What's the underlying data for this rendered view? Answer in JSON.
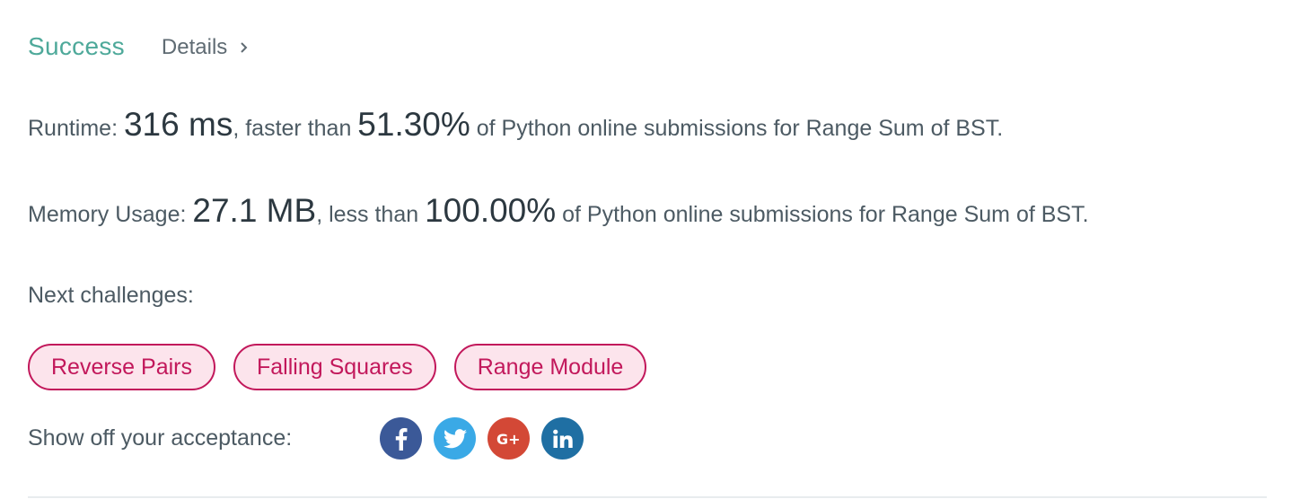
{
  "result": {
    "status": "Success",
    "details_label": "Details"
  },
  "runtime": {
    "label": "Runtime: ",
    "value": "316 ms",
    "comparison": ", faster than ",
    "percent": "51.30%",
    "suffix": " of Python online submissions for Range Sum of BST."
  },
  "memory": {
    "label": "Memory Usage: ",
    "value": "27.1 MB",
    "comparison": ", less than ",
    "percent": "100.00%",
    "suffix": " of Python online submissions for Range Sum of BST."
  },
  "next_challenges": {
    "label": "Next challenges:",
    "items": [
      {
        "label": "Reverse Pairs"
      },
      {
        "label": "Falling Squares"
      },
      {
        "label": "Range Module"
      }
    ]
  },
  "share": {
    "label": "Show off your acceptance:",
    "buttons": [
      {
        "icon": "facebook-icon",
        "color": "#3b5998"
      },
      {
        "icon": "twitter-icon",
        "color": "#3aa9e6"
      },
      {
        "icon": "google-plus-icon",
        "color": "#d34836"
      },
      {
        "icon": "linkedin-icon",
        "color": "#1f6fa3"
      }
    ]
  },
  "colors": {
    "success": "#4ea99a",
    "chip_border": "#c2185b",
    "chip_background": "#fce4ec"
  }
}
